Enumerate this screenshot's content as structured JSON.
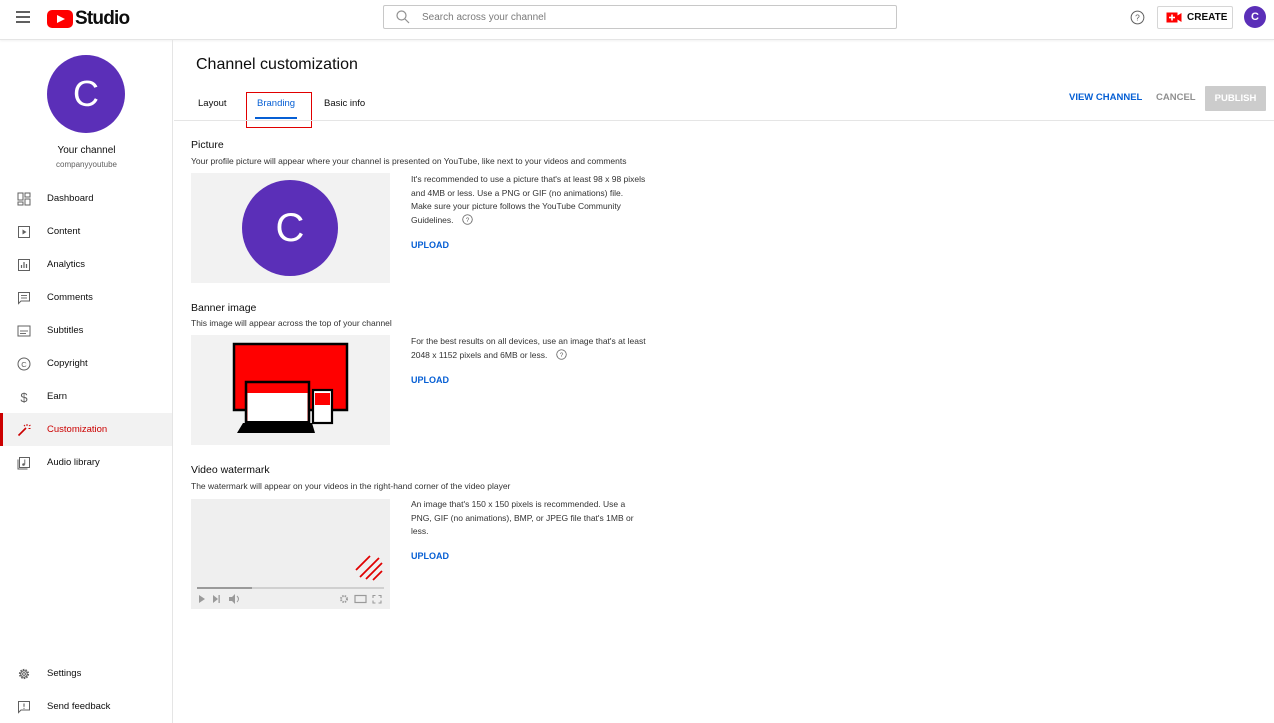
{
  "topbar": {
    "logo_text": "Studio",
    "search_placeholder": "Search across your channel",
    "create_label": "CREATE",
    "avatar_letter": "C"
  },
  "sidebar": {
    "avatar_letter": "C",
    "channel_label": "Your channel",
    "channel_handle": "companyyoutube",
    "items": [
      {
        "label": "Dashboard",
        "icon": "dashboard-icon"
      },
      {
        "label": "Content",
        "icon": "content-icon"
      },
      {
        "label": "Analytics",
        "icon": "analytics-icon"
      },
      {
        "label": "Comments",
        "icon": "comments-icon"
      },
      {
        "label": "Subtitles",
        "icon": "subtitles-icon"
      },
      {
        "label": "Copyright",
        "icon": "copyright-icon"
      },
      {
        "label": "Earn",
        "icon": "earn-icon"
      },
      {
        "label": "Customization",
        "icon": "customization-icon",
        "active": true
      },
      {
        "label": "Audio library",
        "icon": "audio-library-icon"
      }
    ],
    "bottom_items": [
      {
        "label": "Settings",
        "icon": "gear-icon"
      },
      {
        "label": "Send feedback",
        "icon": "feedback-icon"
      }
    ]
  },
  "main": {
    "title": "Channel customization",
    "tabs": [
      {
        "label": "Layout"
      },
      {
        "label": "Branding",
        "active": true
      },
      {
        "label": "Basic info"
      }
    ],
    "actions": {
      "view_channel": "VIEW CHANNEL",
      "cancel": "CANCEL",
      "publish": "PUBLISH"
    },
    "picture": {
      "title": "Picture",
      "description": "Your profile picture will appear where your channel is presented on YouTube, like next to your videos and comments",
      "preview_letter": "C",
      "info": "It's recommended to use a picture that's at least 98 x 98 pixels and 4MB or less. Use a PNG or GIF (no animations) file. Make sure your picture follows the YouTube Community Guidelines.",
      "upload": "UPLOAD"
    },
    "banner": {
      "title": "Banner image",
      "description": "This image will appear across the top of your channel",
      "info": "For the best results on all devices, use an image that's at least 2048 x 1152 pixels and 6MB or less.",
      "upload": "UPLOAD"
    },
    "watermark": {
      "title": "Video watermark",
      "description": "The watermark will appear on your videos in the right-hand corner of the video player",
      "info": "An image that's 150 x 150 pixels is recommended. Use a PNG, GIF (no animations), BMP, or JPEG file that's 1MB or less.",
      "upload": "UPLOAD"
    }
  },
  "colors": {
    "accent_blue": "#065fd4",
    "brand_red": "#ff0000",
    "avatar_purple": "#5b2fb8",
    "active_red": "#cc0000"
  }
}
